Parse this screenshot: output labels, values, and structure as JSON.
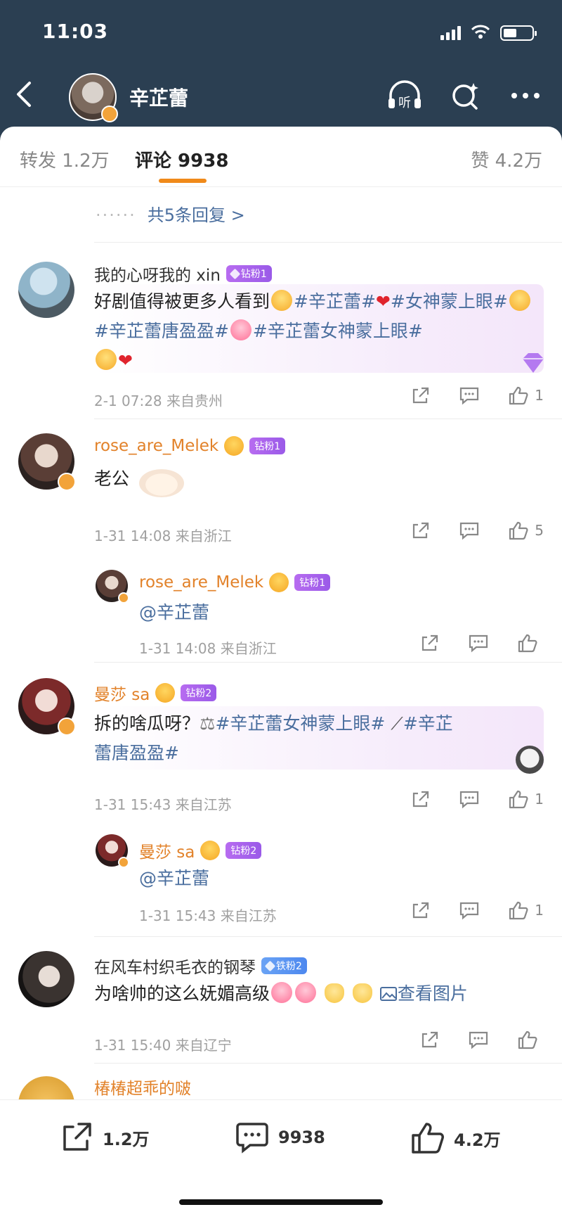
{
  "status_bar": {
    "time": "11:03"
  },
  "nav": {
    "title": "辛芷蕾",
    "icons": [
      "back-icon",
      "listen-icon",
      "search-icon",
      "more-icon"
    ],
    "listen_label": "听"
  },
  "tabs": {
    "repost": "转发 1.2万",
    "comments": "评论 9938",
    "likes": "赞 4.2万"
  },
  "more_replies": "共5条回复 >",
  "comments": [
    {
      "username": "我的心呀我的 xin",
      "badge": "钻粉1",
      "text_parts": [
        "好剧值得被更多人看到",
        "#辛芷蕾#",
        "#女神蒙上眼#",
        "#辛芷蕾唐盈盈#",
        "#辛芷蕾女神蒙上眼#"
      ],
      "time": "2-1 07:28 来自贵州",
      "likes": "1"
    },
    {
      "username": "rose_are_Melek",
      "badge": "钻粉1",
      "text": "老公",
      "time": "1-31 14:08 来自浙江",
      "likes": "5",
      "reply": {
        "username": "rose_are_Melek",
        "badge": "钻粉1",
        "text": "@辛芷蕾",
        "time": "1-31 14:08 来自浙江",
        "likes": ""
      }
    },
    {
      "username": "曼莎 sa",
      "badge": "钻粉2",
      "text_parts": [
        "拆的啥瓜呀？",
        "#辛芷蕾女神蒙上眼#",
        "#辛芷",
        "蕾唐盈盈#"
      ],
      "time": "1-31 15:43 来自江苏",
      "likes": "1",
      "reply": {
        "username": "曼莎 sa",
        "badge": "钻粉2",
        "text": "@辛芷蕾",
        "time": "1-31 15:43 来自江苏",
        "likes": "1"
      }
    },
    {
      "username": "在风车村织毛衣的钢琴",
      "badge": "铁粉2",
      "text": "为啥帅的这么妩媚高级",
      "view_image": "查看图片",
      "time": "1-31 15:40 来自辽宁",
      "likes": ""
    },
    {
      "username": "椿椿超乖的啵"
    }
  ],
  "bottom_bar": {
    "repost": "1.2万",
    "comments": "9938",
    "likes": "4.2万"
  },
  "colors": {
    "header_bg": "#2b3f52",
    "accent_orange": "#f08a1a",
    "topic_blue": "#4a6e9e",
    "badge_purple": "#9a5ae8"
  }
}
